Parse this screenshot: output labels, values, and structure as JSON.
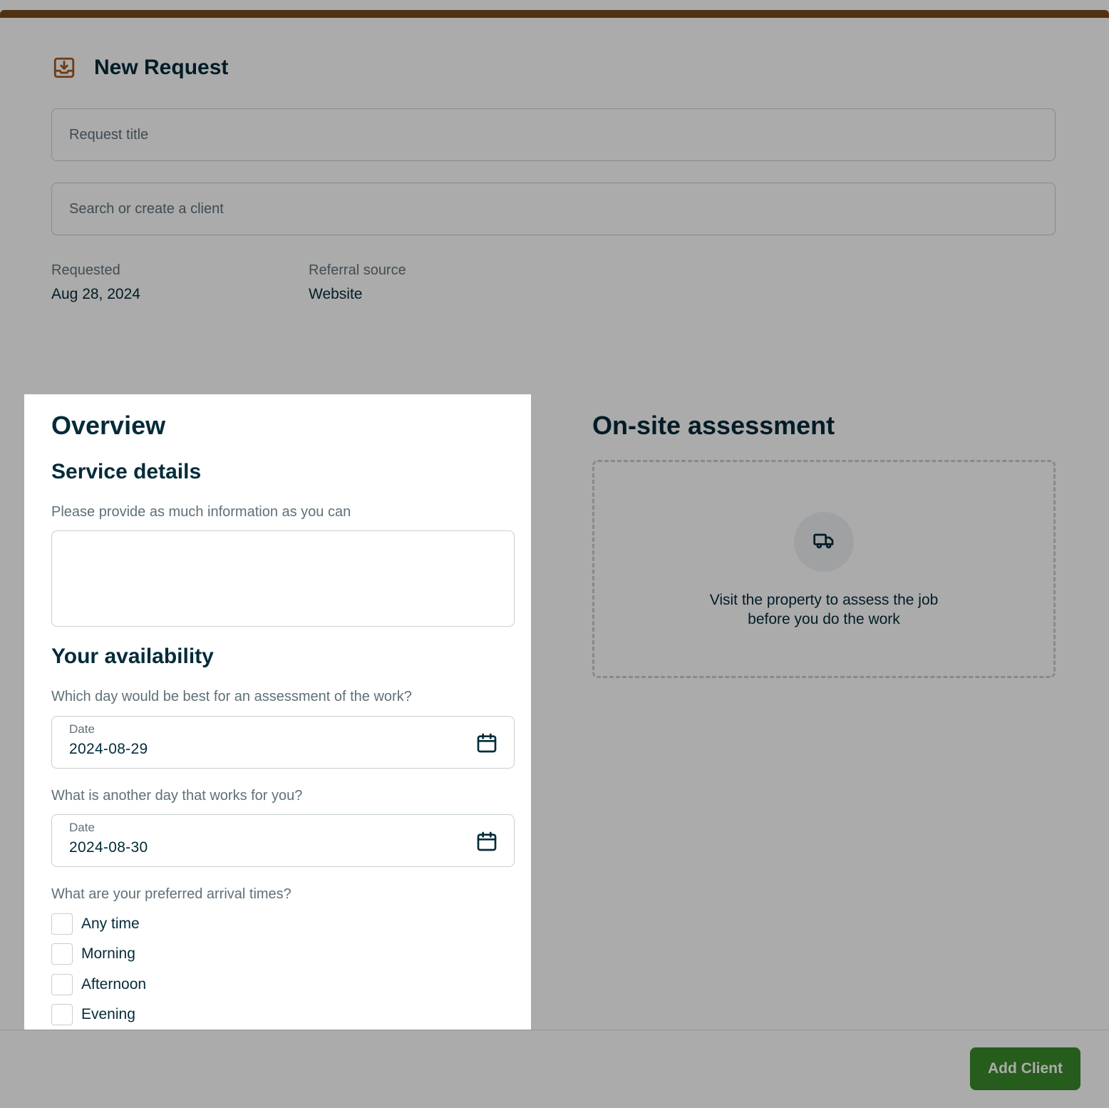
{
  "header": {
    "title": "New Request",
    "title_icon": "inbox-download-icon",
    "request_title_placeholder": "Request title",
    "client_placeholder": "Search or create a client",
    "requested_label": "Requested",
    "requested_value": "Aug 28, 2024",
    "referral_label": "Referral source",
    "referral_value": "Website"
  },
  "overview": {
    "title": "Overview",
    "service_details": {
      "heading": "Service details",
      "prompt": "Please provide as much information as you can",
      "value": ""
    },
    "availability": {
      "heading": "Your availability",
      "first_prompt": "Which day would be best for an assessment of the work?",
      "first_date_label": "Date",
      "first_date_value": "2024-08-29",
      "second_prompt": "What is another day that works for you?",
      "second_date_label": "Date",
      "second_date_value": "2024-08-30",
      "arrival_prompt": "What are your preferred arrival times?",
      "arrival_options": [
        "Any time",
        "Morning",
        "Afternoon",
        "Evening"
      ]
    }
  },
  "onsite": {
    "title": "On-site assessment",
    "icon": "truck-icon",
    "description_line1": "Visit the property to assess the job",
    "description_line2": "before you do the work"
  },
  "footer": {
    "add_client_label": "Add Client"
  },
  "colors": {
    "accent_brown": "#7a4a1e",
    "primary_green": "#3a8a2a",
    "text_dark": "#032b3a"
  }
}
